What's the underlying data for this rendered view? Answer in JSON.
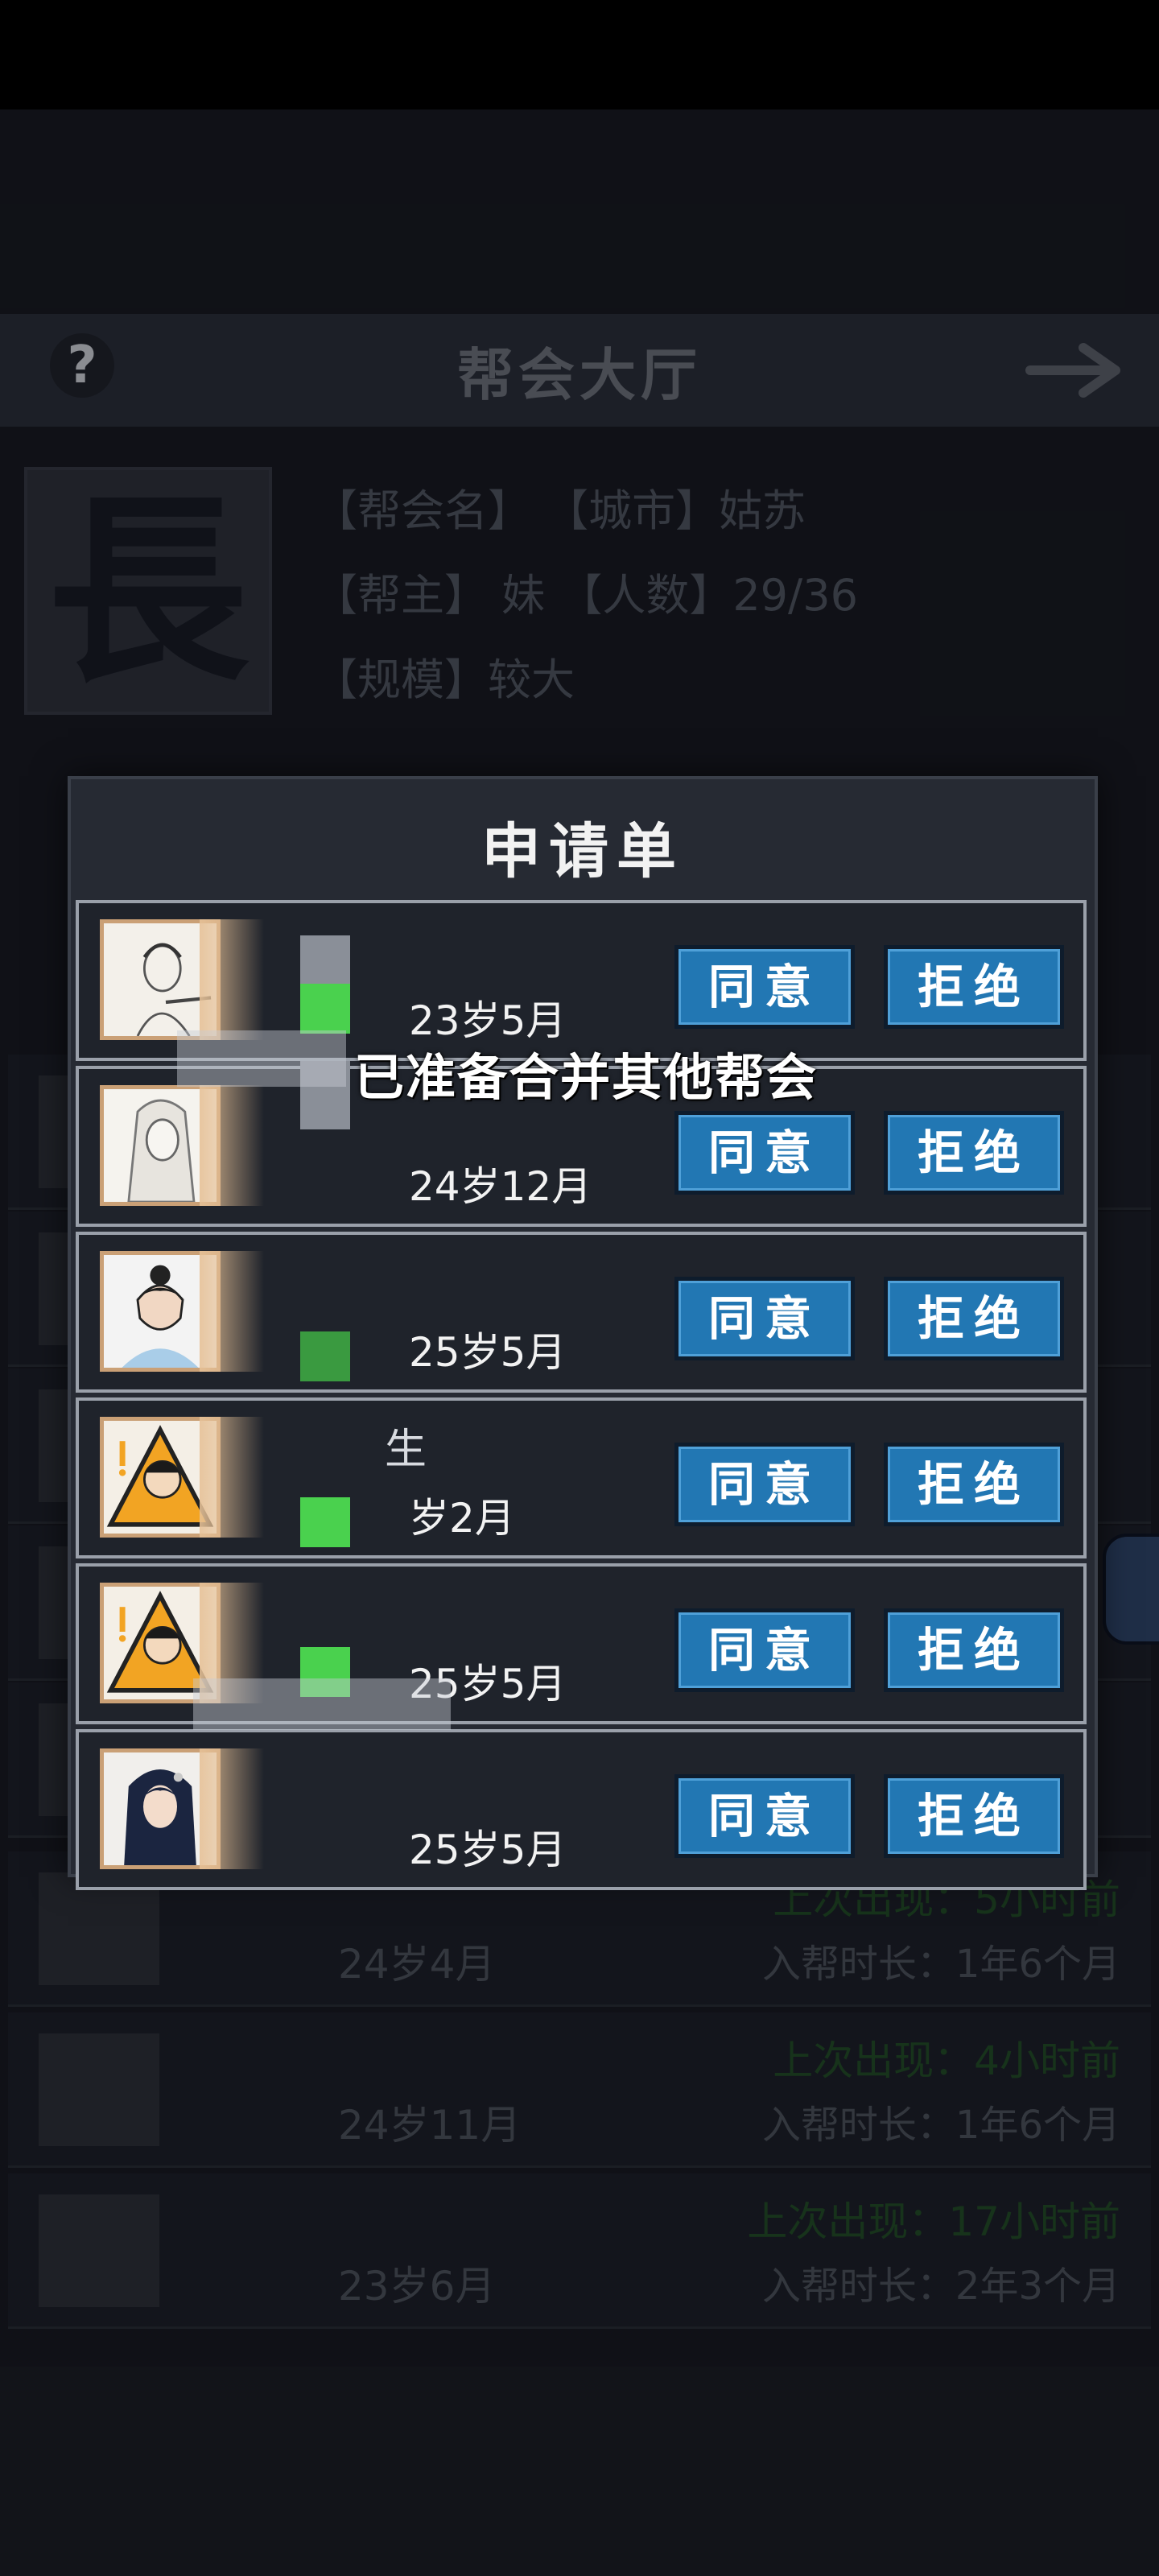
{
  "header": {
    "title": "帮会大厅",
    "help_icon": "?",
    "back_icon": "arrow-right-icon"
  },
  "guild": {
    "emblem_char": "長",
    "line1": "【帮会名】 【城市】姑苏",
    "line2": "【帮主】 妹 【人数】29/36",
    "line3": "【规模】较大"
  },
  "background_members": [
    {
      "age": "24岁4月",
      "last_seen": "上次出现：5小时前",
      "tenure": "入帮时长：1年6个月"
    },
    {
      "age": "24岁11月",
      "last_seen": "上次出现：4小时前",
      "tenure": "入帮时长：1年6个月"
    },
    {
      "age": "23岁6月",
      "last_seen": "上次出现：17小时前",
      "tenure": "入帮时长：2年3个月"
    }
  ],
  "dialog": {
    "title": "申请单",
    "accept_label": "同意",
    "reject_label": "拒绝",
    "applicants": [
      {
        "name": "",
        "age": "23岁5月",
        "avatar": "swordsman-sketch"
      },
      {
        "name": "",
        "age": "24岁12月",
        "avatar": "white-hair-sketch"
      },
      {
        "name": "",
        "age": "25岁5月",
        "avatar": "young-scholar"
      },
      {
        "name": "生",
        "age": "岁2月",
        "avatar": "warning-chibi"
      },
      {
        "name": "",
        "age": "25岁5月",
        "avatar": "warning-chibi"
      },
      {
        "name": "",
        "age": "25岁5月",
        "avatar": "maiden"
      }
    ]
  },
  "toast": {
    "text": "已准备合并其他帮会"
  },
  "colors": {
    "accept": "#2277b3",
    "reject": "#2277b3",
    "online": "#4ad14e",
    "panel": "#262a33"
  }
}
